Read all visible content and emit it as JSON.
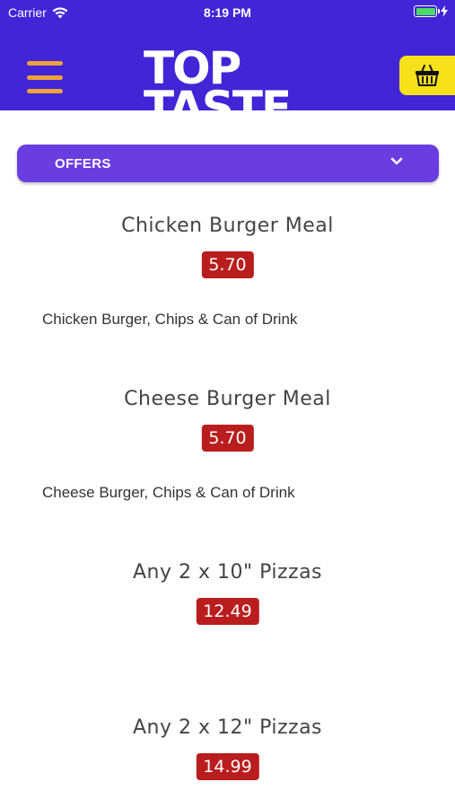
{
  "status_bar": {
    "carrier": "Carrier",
    "time": "8:19 PM"
  },
  "header": {
    "logo_line1": "TOP",
    "logo_line2": "TASTE",
    "accent_color": "#4125d6",
    "menu_icon_color": "#f0a23a",
    "cart_button_color": "#f7e11a"
  },
  "category": {
    "label": "OFFERS",
    "icon": "chevron-down-icon",
    "color": "#6a3de0"
  },
  "items": [
    {
      "title": "Chicken Burger Meal",
      "price": "5.70",
      "description": "Chicken Burger, Chips & Can of Drink"
    },
    {
      "title": "Cheese Burger Meal",
      "price": "5.70",
      "description": "Cheese Burger, Chips & Can of Drink"
    },
    {
      "title": "Any 2 x 10\" Pizzas",
      "price": "12.49",
      "description": ""
    },
    {
      "title": "Any 2 x 12\" Pizzas",
      "price": "14.99",
      "description": ""
    }
  ],
  "price_badge_color": "#b91d1d"
}
